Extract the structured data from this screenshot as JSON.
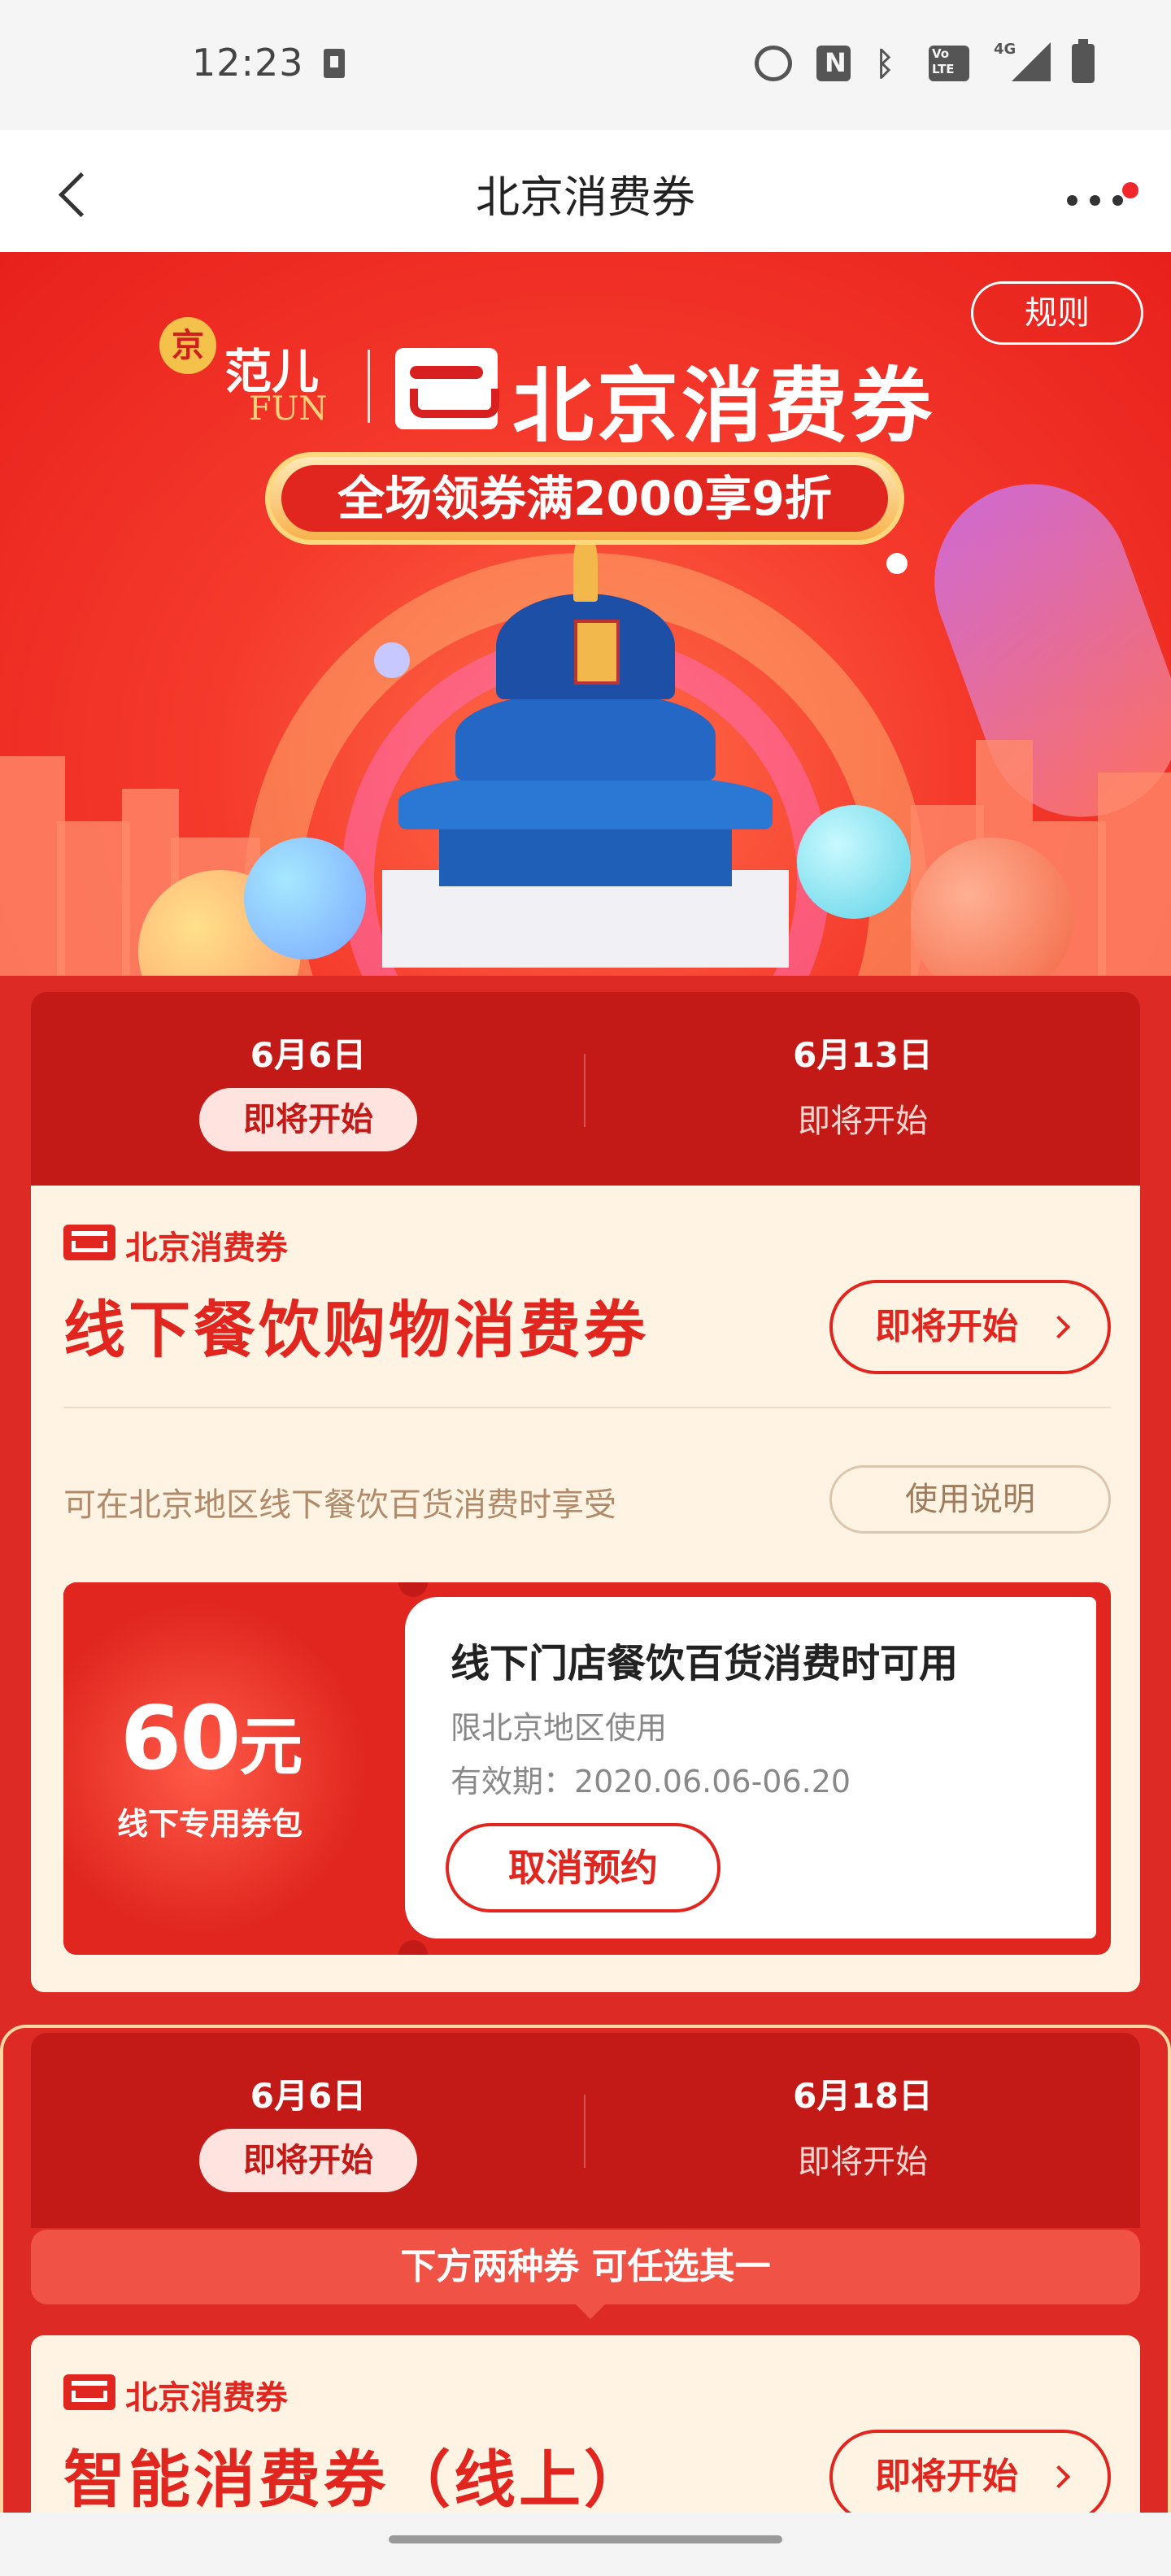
{
  "status_bar": {
    "time": "12:23",
    "icons": [
      "download-icon",
      "alarm-icon",
      "nfc-icon",
      "bluetooth-icon",
      "volte-icon",
      "signal-4g-icon",
      "battery-icon"
    ],
    "network_label": "4G"
  },
  "header": {
    "title": "北京消费券",
    "back_icon": "back-icon",
    "more_icon": "more-icon"
  },
  "hero": {
    "festival_badge": "京",
    "festival_text": "范儿",
    "festival_fun": "FUN",
    "brand_title": "北京消费券",
    "promo": "全场领券满2000享9折",
    "rules_label": "规则"
  },
  "section1": {
    "dates": [
      {
        "date": "6月6日",
        "status": "即将开始",
        "active": true
      },
      {
        "date": "6月13日",
        "status": "即将开始",
        "active": false
      }
    ],
    "card": {
      "brand": "北京消费券",
      "title": "线下餐饮购物消费券",
      "status_label": "即将开始",
      "description": "可在北京地区线下餐饮百货消费时享受",
      "usage_label": "使用说明",
      "ticket": {
        "amount": "60",
        "unit": "元",
        "pack_label": "线下专用券包",
        "title": "线下门店餐饮百货消费时可用",
        "region": "限北京地区使用",
        "validity": "有效期：2020.06.06-06.20",
        "cancel_label": "取消预约"
      }
    }
  },
  "section2": {
    "dates": [
      {
        "date": "6月6日",
        "status": "即将开始",
        "active": true
      },
      {
        "date": "6月18日",
        "status": "即将开始",
        "active": false
      }
    ],
    "banner": "下方两种券 可任选其一",
    "card": {
      "brand": "北京消费券",
      "title": "智能消费券（线上）",
      "status_label": "即将开始"
    }
  },
  "colors": {
    "accent_red": "#e0261f",
    "dark_red": "#c41a17",
    "card_cream": "#fff4e3"
  }
}
